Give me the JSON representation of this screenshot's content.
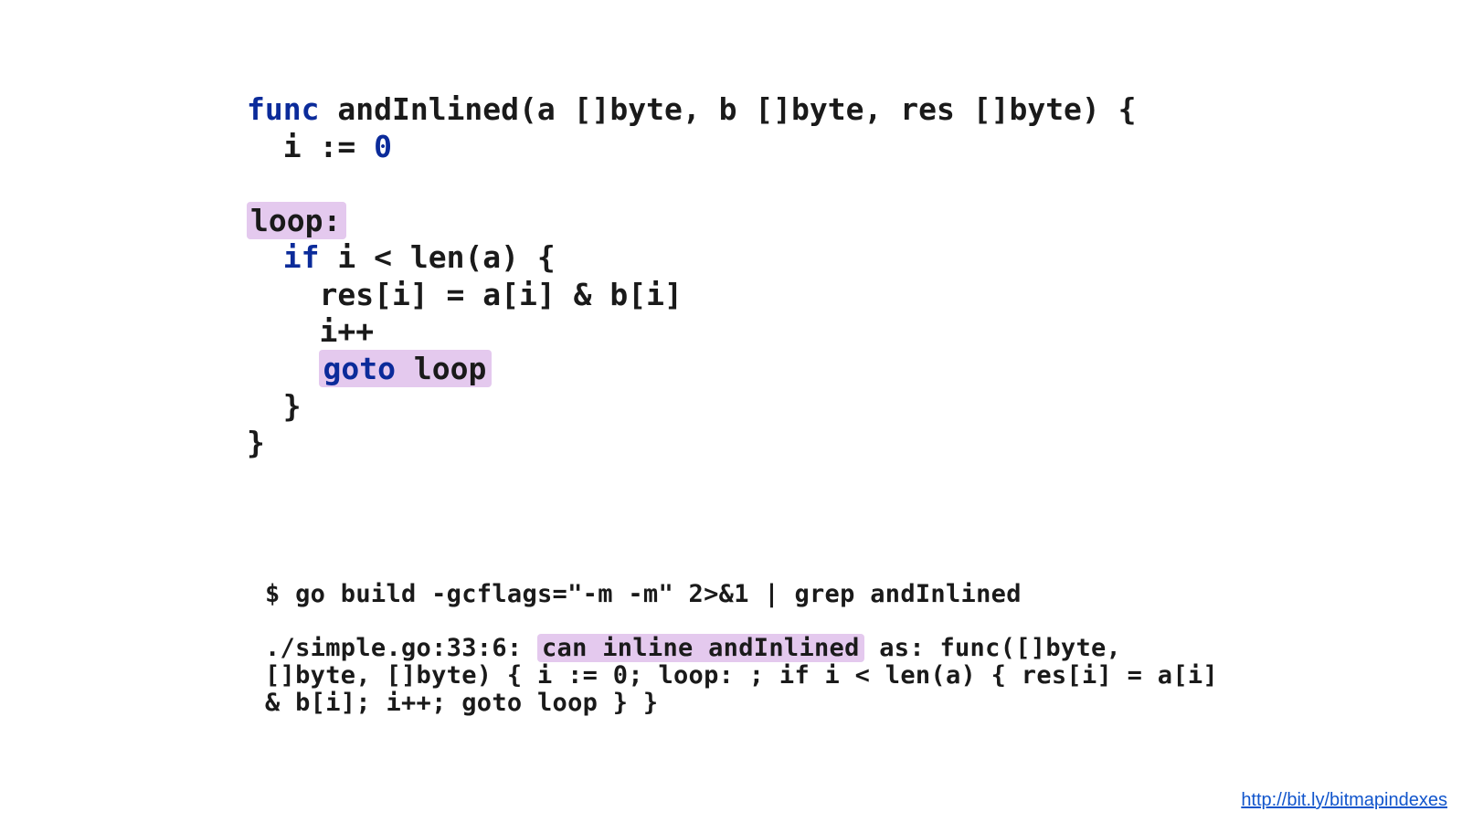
{
  "code": {
    "l1_kw": "func",
    "l1_rest": " andInlined(a []byte, b []byte, res []byte) {",
    "l2_pre": "  i := ",
    "l2_num": "0",
    "l3": "",
    "l4_hl": "loop:",
    "l5_pre": "  ",
    "l5_kw": "if",
    "l5_rest": " i < len(a) {",
    "l6": "    res[i] = a[i] & b[i]",
    "l7": "    i++",
    "l8_pre": "    ",
    "l8_kw": "goto",
    "l8_rest": " loop",
    "l9": "  }",
    "l10": "}"
  },
  "term": {
    "cmd": "$ go build -gcflags=\"-m -m\" 2>&1 | grep andInlined",
    "out_pre": "./simple.go:33:6: ",
    "out_hl": "can inline andInlined",
    "out_post": " as: func([]byte, []byte, []byte) { i := 0; loop: ; if i < len(a) { res[i] = a[i] & b[i]; i++; goto loop } }"
  },
  "link": {
    "text": "http://bit.ly/bitmapindexes"
  }
}
